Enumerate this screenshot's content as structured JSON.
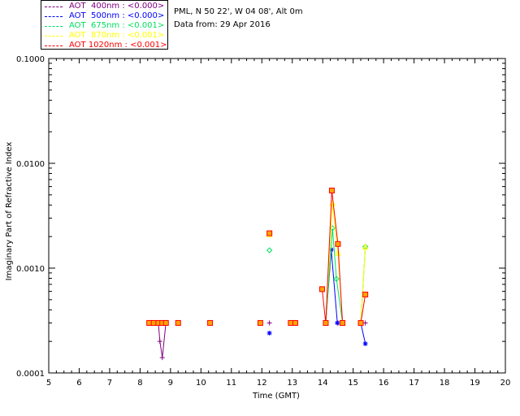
{
  "chart_data": {
    "type": "scatter",
    "title": "",
    "xlabel": "Time (GMT)",
    "ylabel": "Imaginary Part of Refractive Index",
    "xlim": [
      5,
      20
    ],
    "ylim": [
      0.0001,
      0.1
    ],
    "yscale": "log",
    "x_ticks": [
      "5",
      "6",
      "7",
      "8",
      "9",
      "10",
      "11",
      "12",
      "13",
      "14",
      "15",
      "16",
      "17",
      "18",
      "19",
      "20"
    ],
    "y_ticks": [
      "0.0001",
      "0.0010",
      "0.0100",
      "0.1000"
    ],
    "grid": false,
    "legend": "top-left",
    "series": [
      {
        "name": "AOT  400nm : <0.000>",
        "color": "#800080",
        "marker": "plus",
        "segments": [
          [
            [
              8.3,
              0.0003
            ],
            [
              8.45,
              0.0003
            ],
            [
              8.6,
              0.0003
            ],
            [
              8.65,
              0.0002
            ],
            [
              8.73,
              0.00014
            ],
            [
              8.85,
              0.0003
            ]
          ],
          [
            [
              9.25,
              0.0003
            ]
          ],
          [
            [
              10.3,
              0.0003
            ]
          ],
          [
            [
              11.95,
              0.0003
            ]
          ],
          [
            [
              12.25,
              0.0003
            ]
          ],
          [
            [
              12.95,
              0.0003
            ],
            [
              13.1,
              0.0003
            ]
          ],
          [
            [
              14.1,
              0.0003
            ]
          ],
          [
            [
              14.5,
              0.0003
            ]
          ],
          [
            [
              14.65,
              0.0003
            ]
          ],
          [
            [
              15.25,
              0.0003
            ],
            [
              15.4,
              0.0003
            ]
          ]
        ]
      },
      {
        "name": "AOT  500nm : <0.000>",
        "color": "#0000ff",
        "marker": "asterisk",
        "segments": [
          [
            [
              12.25,
              0.00024
            ]
          ],
          [
            [
              14.1,
              0.0003
            ],
            [
              14.28,
              0.0015
            ],
            [
              14.48,
              0.0003
            ]
          ],
          [
            [
              15.25,
              0.0003
            ],
            [
              15.4,
              0.00019
            ]
          ]
        ]
      },
      {
        "name": "AOT  675nm : <0.001>",
        "color": "#00e060",
        "marker": "diamond",
        "segments": [
          [
            [
              12.25,
              0.00148
            ]
          ],
          [
            [
              14.1,
              0.0003
            ],
            [
              14.32,
              0.0024
            ],
            [
              14.45,
              0.00079
            ],
            [
              14.65,
              0.0003
            ]
          ],
          [
            [
              15.25,
              0.0003
            ],
            [
              15.4,
              0.0016
            ]
          ]
        ]
      },
      {
        "name": "AOT  870nm : <0.001>",
        "color": "#ffff00",
        "marker": "triangle",
        "segments": [
          [
            [
              12.25,
              0.0021
            ]
          ],
          [
            [
              14.1,
              0.0003
            ],
            [
              14.32,
              0.0042
            ],
            [
              14.5,
              0.0014
            ],
            [
              14.65,
              0.0003
            ]
          ],
          [
            [
              15.25,
              0.0003
            ],
            [
              15.4,
              0.0016
            ]
          ]
        ]
      },
      {
        "name": "AOT 1020nm : <0.001>",
        "color": "#ff0000",
        "marker": "square",
        "fill": "#ffa500",
        "segments": [
          [
            [
              8.3,
              0.0003
            ],
            [
              8.45,
              0.0003
            ],
            [
              8.6,
              0.0003
            ],
            [
              8.73,
              0.0003
            ],
            [
              8.85,
              0.0003
            ]
          ],
          [
            [
              9.25,
              0.0003
            ]
          ],
          [
            [
              10.3,
              0.0003
            ]
          ],
          [
            [
              11.95,
              0.0003
            ]
          ],
          [
            [
              12.25,
              0.00215
            ]
          ],
          [
            [
              12.95,
              0.0003
            ],
            [
              13.1,
              0.0003
            ]
          ],
          [
            [
              13.98,
              0.00063
            ],
            [
              14.1,
              0.0003
            ],
            [
              14.3,
              0.0055
            ],
            [
              14.5,
              0.0017
            ],
            [
              14.65,
              0.0003
            ]
          ],
          [
            [
              15.25,
              0.0003
            ],
            [
              15.4,
              0.00056
            ]
          ]
        ]
      }
    ]
  },
  "info": {
    "location": "PML, N 50 22', W 04 08', Alt 0m",
    "date": "Data from: 29 Apr 2016"
  }
}
